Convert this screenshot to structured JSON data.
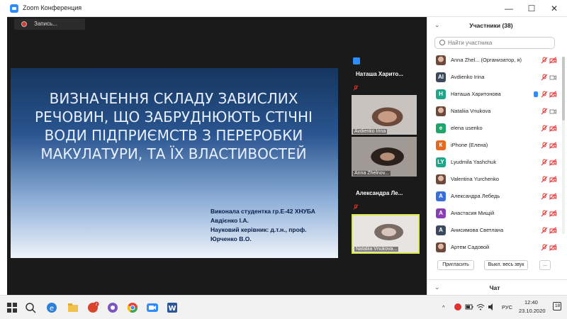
{
  "window": {
    "title": "Zoom Конференция"
  },
  "recording": {
    "label": "Запись..."
  },
  "slide": {
    "title_lines": [
      "ВИЗНАЧЕННЯ СКЛАДУ ЗАВИСЛИХ",
      "РЕЧОВИН, ЩО ЗАБРУДНЮЮТЬ СТІЧНІ",
      "ВОДИ ПІДПРИЄМСТВ З ПЕРЕРОБКИ",
      "МАКУЛАТУРИ, ТА ЇХ ВЛАСТИВОСТЕЙ"
    ],
    "credits": [
      "Виконала студентка гр.Е-42 ХНУБА",
      "Авдієнко І.А.",
      "Науковий керівник: д.т.н., проф.",
      "Юрченко В.О."
    ]
  },
  "gallery": [
    {
      "kind": "name",
      "label": "Наташа Харито..."
    },
    {
      "kind": "video",
      "label": "Avdienko Irina"
    },
    {
      "kind": "video",
      "label": "Anna Zhelnov..."
    },
    {
      "kind": "name",
      "label": "Александра Ле..."
    },
    {
      "kind": "video",
      "label": "Nataliia Vnukova..."
    }
  ],
  "participants_panel": {
    "title": "Участники (38)",
    "search_placeholder": "Найти участника",
    "items": [
      {
        "name": "Anna Zhel... (Организатор, я)",
        "initial": "",
        "avatar_color": "",
        "photo": true,
        "hand": false,
        "video_on": false
      },
      {
        "name": "Avdienko Irina",
        "initial": "AI",
        "avatar_color": "#3a4a5c",
        "photo": false,
        "hand": false,
        "video_on": true
      },
      {
        "name": "Наташа Харитонова",
        "initial": "Н",
        "avatar_color": "#1fa58a",
        "photo": false,
        "hand": true,
        "video_on": false
      },
      {
        "name": "Nataliia Vnukova",
        "initial": "",
        "avatar_color": "",
        "photo": true,
        "hand": false,
        "video_on": true
      },
      {
        "name": "elena usenko",
        "initial": "e",
        "avatar_color": "#1fa56b",
        "photo": false,
        "hand": false,
        "video_on": false
      },
      {
        "name": "iPhone (Елена)",
        "initial": "К",
        "avatar_color": "#e56a1f",
        "photo": false,
        "hand": false,
        "video_on": false
      },
      {
        "name": "Lyudmila Yashchuk",
        "initial": "LY",
        "avatar_color": "#1fa58a",
        "photo": false,
        "hand": false,
        "video_on": false
      },
      {
        "name": "Valentina Yurchenko",
        "initial": "",
        "avatar_color": "",
        "photo": true,
        "hand": false,
        "video_on": false
      },
      {
        "name": "Александра Лебедь",
        "initial": "А",
        "avatar_color": "#3b6fd8",
        "photo": false,
        "hand": false,
        "video_on": false
      },
      {
        "name": "Анастасия Мищій",
        "initial": "А",
        "avatar_color": "#8a3fb5",
        "photo": false,
        "hand": false,
        "video_on": false
      },
      {
        "name": "Анисимова Светлана",
        "initial": "А",
        "avatar_color": "#3a4a5c",
        "photo": false,
        "hand": false,
        "video_on": false
      },
      {
        "name": "Артем Садовой",
        "initial": "",
        "avatar_color": "",
        "photo": true,
        "hand": false,
        "video_on": false
      }
    ],
    "buttons": {
      "invite": "Пригласить",
      "mute_all": "Выкл. весь звук",
      "more": "..."
    },
    "chat_title": "Чат"
  },
  "taskbar": {
    "notification_count": "18",
    "language": "РУС",
    "time": "12:40",
    "date": "23.10.2020"
  },
  "colors": {
    "zoom_blue": "#2d8cff",
    "muted_red": "#e0332f",
    "active_border": "#d8e84a"
  }
}
